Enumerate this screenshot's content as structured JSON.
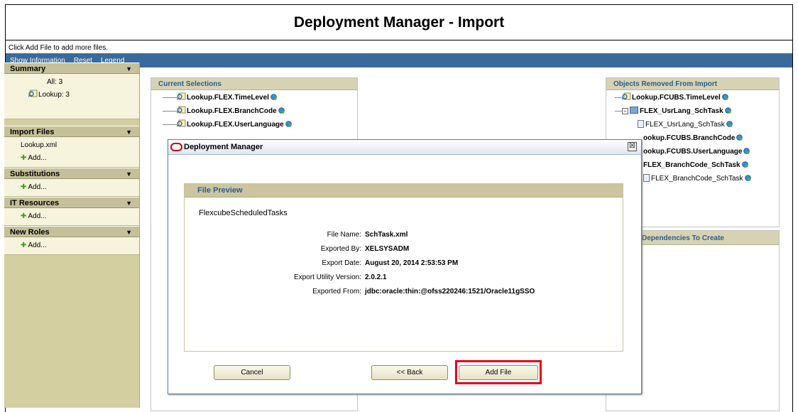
{
  "page": {
    "title": "Deployment Manager - Import",
    "hint": "Click Add File to add more files."
  },
  "toolbar": {
    "items": [
      "Show Information",
      "Reset",
      "Legend"
    ]
  },
  "sidebar": {
    "summary": {
      "label": "Summary",
      "all": "All: 3",
      "lookup": "Lookup: 3"
    },
    "import_files": {
      "label": "Import Files",
      "file": "Lookup.xml",
      "add": "Add..."
    },
    "substitutions": {
      "label": "Substitutions",
      "add": "Add..."
    },
    "it_resources": {
      "label": "IT Resources",
      "add": "Add..."
    },
    "new_roles": {
      "label": "New Roles",
      "add": "Add..."
    },
    "arrow_glyph": "▼"
  },
  "current_selections": {
    "title": "Current Selections",
    "items": [
      "Lookup.FLEX.TimeLevel",
      "Lookup.FLEX.BranchCode",
      "Lookup.FLEX.UserLanguage"
    ]
  },
  "removed": {
    "title": "Objects Removed From Import",
    "items": [
      "Lookup.FCUBS.TimeLevel",
      "FLEX_UsrLang_SchTask",
      "FLEX_UsrLang_SchTask",
      "Lookup.FCUBS.BranchCode",
      "Lookup.FCUBS.UserLanguage",
      "FLEX_BranchCode_SchTask",
      "FLEX_BranchCode_SchTask"
    ],
    "partial_items": [
      "ookup.FCUBS.BranchCode",
      "ookup.FCUBS.UserLanguage",
      "FLEX_BranchCode_SchTask"
    ]
  },
  "dependencies": {
    "title": "Dependencies To Create"
  },
  "modal": {
    "title": "Deployment Manager",
    "close": "☒",
    "preview_title": "File Preview",
    "preview_name": "FlexcubeScheduledTasks",
    "fields": [
      {
        "label": "File Name:",
        "value": "SchTask.xml"
      },
      {
        "label": "Exported By:",
        "value": "XELSYSADM"
      },
      {
        "label": "Export Date:",
        "value": "August 20, 2014 2:53:53 PM"
      },
      {
        "label": "Export Utility Version:",
        "value": "2.0.2.1"
      },
      {
        "label": "Exported From:",
        "value": "jdbc:oracle:thin:@ofss220246:1521/Oracle11gSSO"
      }
    ],
    "buttons": {
      "cancel": "Cancel",
      "back": "<< Back",
      "add_file": "Add File"
    }
  },
  "colors": {
    "toolbar_bg": "#3a6a99",
    "sidebar_bg": "#d4cfa1",
    "panel_header_text": "#2c5c8c",
    "highlight": "#e3001b"
  }
}
